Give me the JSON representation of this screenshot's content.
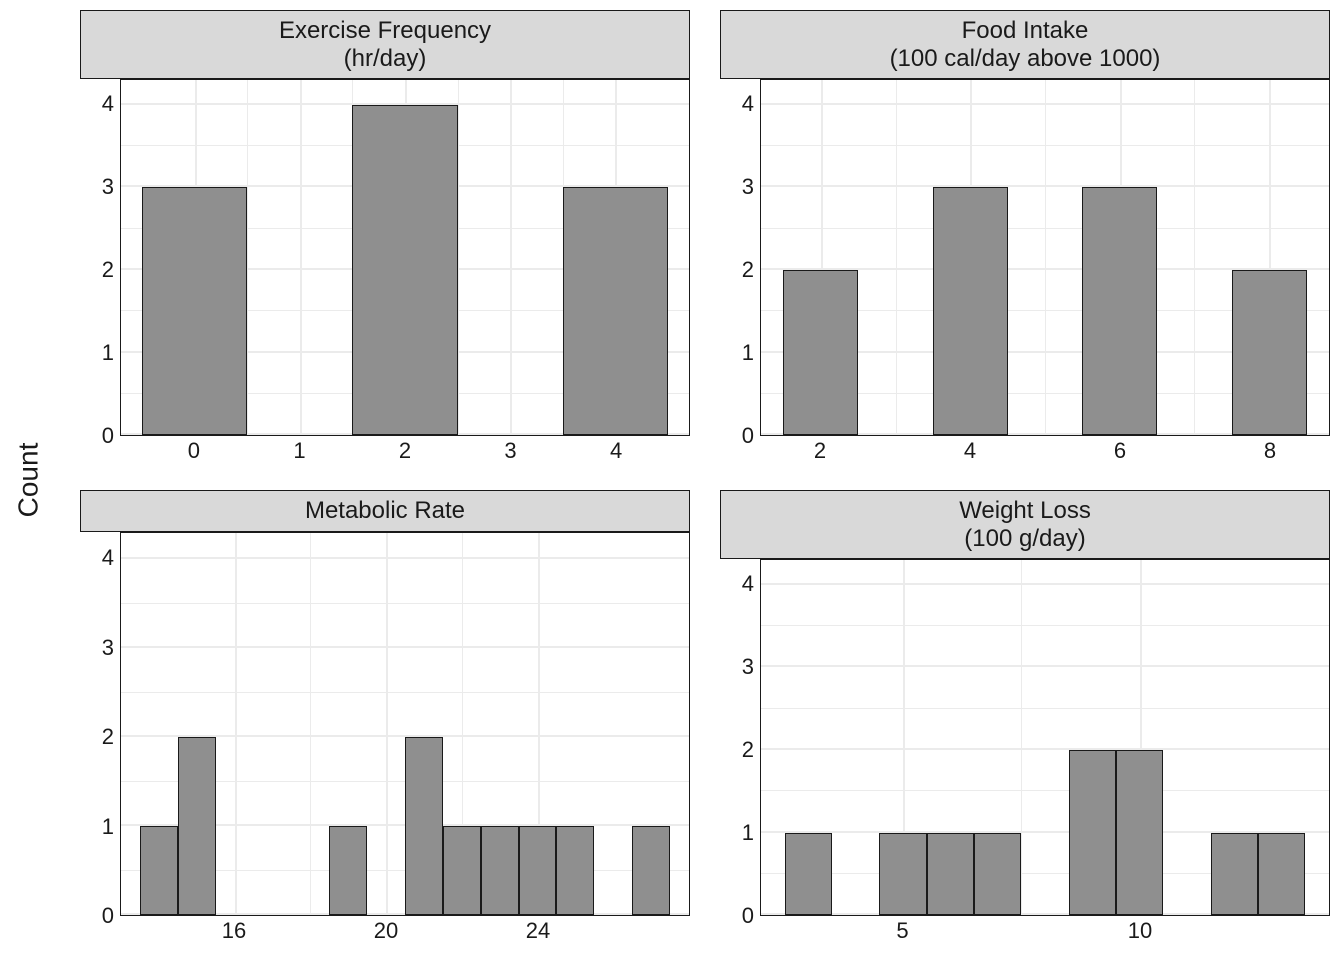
{
  "ylabel": "Count",
  "chart_data": [
    {
      "type": "bar",
      "title": "Exercise Frequency\n(hr/day)",
      "ylim": [
        0,
        4.3
      ],
      "y_ticks": [
        0,
        1,
        2,
        3,
        4
      ],
      "x_ticks_labels": [
        "0",
        "1",
        "2",
        "3",
        "4"
      ],
      "x_ticks_values": [
        0,
        1,
        2,
        3,
        4
      ],
      "xlim": [
        -0.7,
        4.7
      ],
      "bar_width": 1.0,
      "bars": [
        {
          "x": 0,
          "count": 3
        },
        {
          "x": 2,
          "count": 4
        },
        {
          "x": 4,
          "count": 3
        }
      ]
    },
    {
      "type": "bar",
      "title": "Food Intake\n(100 cal/day above 1000)",
      "ylim": [
        0,
        4.3
      ],
      "y_ticks": [
        0,
        1,
        2,
        3,
        4
      ],
      "x_ticks_labels": [
        "2",
        "4",
        "6",
        "8"
      ],
      "x_ticks_values": [
        2,
        4,
        6,
        8
      ],
      "xlim": [
        1.2,
        8.8
      ],
      "bar_width": 1.0,
      "bars": [
        {
          "x": 2,
          "count": 2
        },
        {
          "x": 4,
          "count": 3
        },
        {
          "x": 6,
          "count": 3
        },
        {
          "x": 8,
          "count": 2
        }
      ]
    },
    {
      "type": "bar",
      "title": "Metabolic Rate",
      "ylim": [
        0,
        4.3
      ],
      "y_ticks": [
        0,
        1,
        2,
        3,
        4
      ],
      "x_ticks_labels": [
        "16",
        "20",
        "24"
      ],
      "x_ticks_values": [
        16,
        20,
        24
      ],
      "xlim": [
        13,
        28
      ],
      "bar_width": 1.0,
      "bars": [
        {
          "x": 14,
          "count": 1
        },
        {
          "x": 15,
          "count": 2
        },
        {
          "x": 19,
          "count": 1
        },
        {
          "x": 21,
          "count": 2
        },
        {
          "x": 22,
          "count": 1
        },
        {
          "x": 23,
          "count": 1
        },
        {
          "x": 24,
          "count": 1
        },
        {
          "x": 25,
          "count": 1
        },
        {
          "x": 27,
          "count": 1
        }
      ]
    },
    {
      "type": "bar",
      "title": "Weight Loss\n(100 g/day)",
      "ylim": [
        0,
        4.3
      ],
      "y_ticks": [
        0,
        1,
        2,
        3,
        4
      ],
      "x_ticks_labels": [
        "5",
        "10"
      ],
      "x_ticks_values": [
        5,
        10
      ],
      "xlim": [
        2,
        14
      ],
      "bar_width": 1.0,
      "bars": [
        {
          "x": 3,
          "count": 1
        },
        {
          "x": 5,
          "count": 1
        },
        {
          "x": 6,
          "count": 1
        },
        {
          "x": 7,
          "count": 1
        },
        {
          "x": 9,
          "count": 2
        },
        {
          "x": 10,
          "count": 2
        },
        {
          "x": 12,
          "count": 1
        },
        {
          "x": 13,
          "count": 1
        }
      ]
    }
  ]
}
